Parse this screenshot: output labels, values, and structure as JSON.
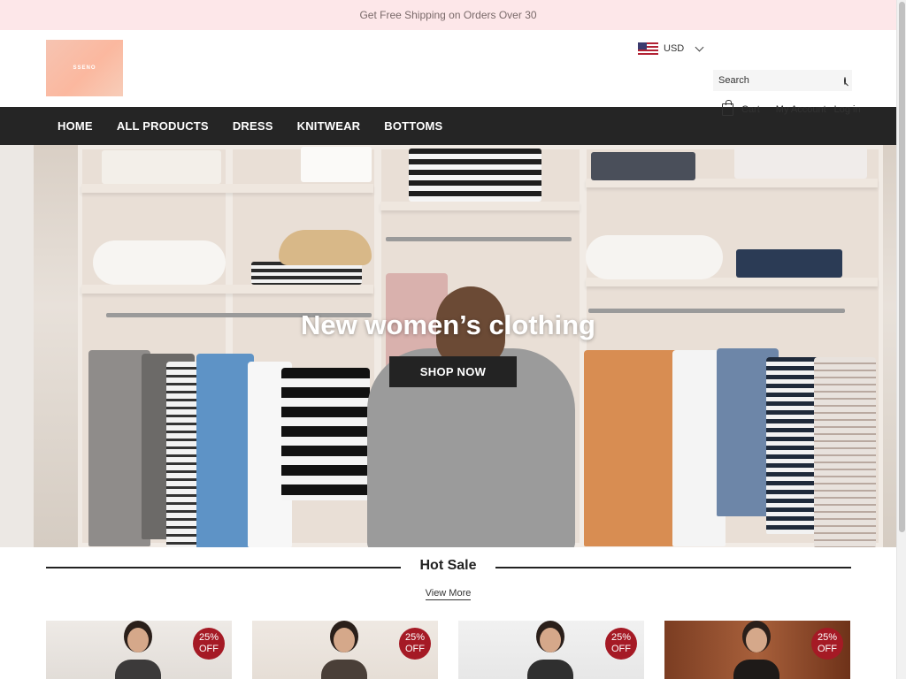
{
  "announcement": "Get Free Shipping on Orders Over 30",
  "logo": {
    "text": "SSENO"
  },
  "currency": {
    "code": "USD",
    "flag": "us-flag-icon"
  },
  "search": {
    "placeholder": "Search"
  },
  "header_links": {
    "cart": "Cart",
    "account": "My Account",
    "login": "Log in"
  },
  "nav": {
    "items": [
      "HOME",
      "ALL PRODUCTS",
      "DRESS",
      "KNITWEAR",
      "BOTTOMS"
    ]
  },
  "hero": {
    "title": "New women’s clothing",
    "button": "SHOP NOW"
  },
  "hot_sale": {
    "title": "Hot Sale",
    "view_more": "View More"
  },
  "products": [
    {
      "badge_top": "25%",
      "badge_bottom": "OFF"
    },
    {
      "badge_top": "25%",
      "badge_bottom": "OFF"
    },
    {
      "badge_top": "25%",
      "badge_bottom": "OFF"
    },
    {
      "badge_top": "25%",
      "badge_bottom": "OFF"
    }
  ],
  "colors": {
    "announce_bg": "#fde7e9",
    "nav_bg": "#252525",
    "badge": "#a51a25",
    "logo": "#fbb89f"
  }
}
